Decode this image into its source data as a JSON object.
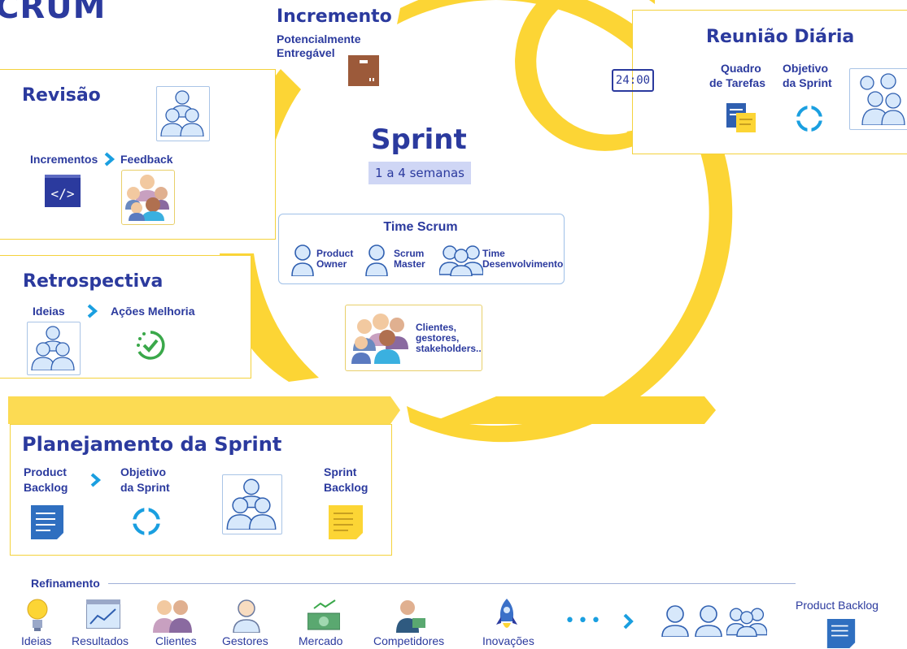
{
  "title": "CRUM",
  "sprint": {
    "title": "Sprint",
    "duration": "1 a 4 semanas"
  },
  "time_scrum": {
    "title": "Time Scrum",
    "roles": [
      {
        "label1": "Product",
        "label2": "Owner"
      },
      {
        "label1": "Scrum",
        "label2": "Master"
      },
      {
        "label1": "Time",
        "label2": "Desenvolvimento"
      }
    ]
  },
  "stakeholders": {
    "line1": "Clientes,",
    "line2": "gestores,",
    "line3": "stakeholders.."
  },
  "incremento": {
    "title": "Incremento",
    "line1": "Potencialmente",
    "line2": "Entregável"
  },
  "reuniao": {
    "title": "Reunião Diária",
    "clock": "24:00",
    "item1_line1": "Quadro",
    "item1_line2": "de Tarefas",
    "item2_line1": "Objetivo",
    "item2_line2": "da Sprint"
  },
  "revisao": {
    "title": "Revisão",
    "item1": "Incrementos",
    "item2": "Feedback",
    "code": "</>"
  },
  "retrospectiva": {
    "title": "Retrospectiva",
    "item1": "Ideias",
    "item2": "Ações Melhoria"
  },
  "planejamento": {
    "title": "Planejamento da Sprint",
    "item1_line1": "Product",
    "item1_line2": "Backlog",
    "item2_line1": "Objetivo",
    "item2_line2": "da Sprint",
    "item3_line1": "Sprint",
    "item3_line2": "Backlog"
  },
  "refinamento": {
    "title": "Refinamento",
    "items": [
      "Ideias",
      "Resultados",
      "Clientes",
      "Gestores",
      "Mercado",
      "Competidores",
      "Inovações"
    ],
    "ellipsis": "•••",
    "product_backlog": "Product Backlog"
  },
  "colors": {
    "navy": "#2b3a9e",
    "yellow": "#fcd535",
    "blue": "#1a9fe0",
    "lightblue": "#a9c4e6"
  }
}
